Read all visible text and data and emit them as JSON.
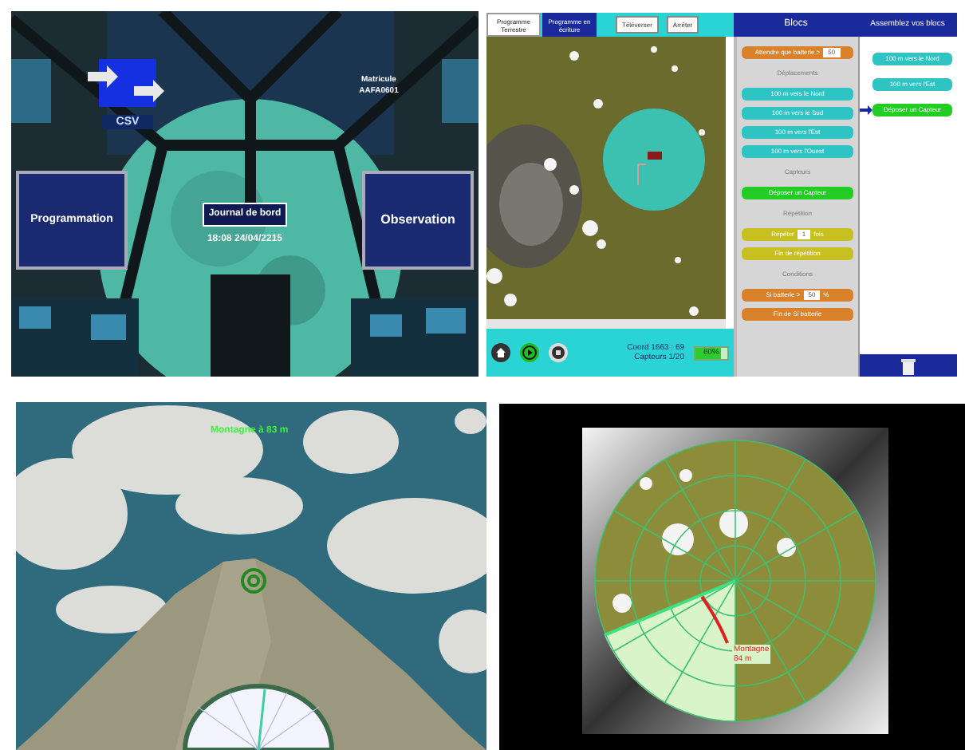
{
  "cockpit": {
    "csv_label": "CSV",
    "id_label": "Matricule AAFA0601",
    "buttons": [
      "Programmation",
      "Observation"
    ],
    "logbook": "Journal de bord",
    "timestamp": "18:08 24/04/2215"
  },
  "programming": {
    "tabs": [
      {
        "label": "Programme Terrestre",
        "selected": true
      },
      {
        "label": "Programme en écriture",
        "selected": false
      }
    ],
    "actions": [
      "Téléverser",
      "Arrêter"
    ],
    "palette_title": "Blocs",
    "workspace_title": "Assemblez vos blocs",
    "palette": [
      {
        "kind": "input",
        "label": "Attendre que batterie >",
        "value": "50",
        "color": "#d9822b"
      },
      {
        "kind": "heading",
        "label": "Déplacements"
      },
      {
        "kind": "block",
        "label": "100 m vers le Nord",
        "color": "#2ec4c4"
      },
      {
        "kind": "block",
        "label": "100 m vers le Sud",
        "color": "#2ec4c4"
      },
      {
        "kind": "block",
        "label": "100 m vers l'Est",
        "color": "#2ec4c4"
      },
      {
        "kind": "block",
        "label": "100 m vers l'Ouest",
        "color": "#2ec4c4"
      },
      {
        "kind": "heading",
        "label": "Capteurs"
      },
      {
        "kind": "block",
        "label": "Déposer un Capteur",
        "color": "#22cc22"
      },
      {
        "kind": "heading",
        "label": "Répétition"
      },
      {
        "kind": "input",
        "label": "Répéter",
        "value": "1",
        "unit": "fois",
        "color": "#c8c020"
      },
      {
        "kind": "block",
        "label": "Fin de répétition",
        "color": "#c8c020"
      },
      {
        "kind": "heading",
        "label": "Conditions"
      },
      {
        "kind": "input",
        "label": "Si batterie >",
        "value": "50",
        "unit": "%",
        "color": "#d9822b"
      },
      {
        "kind": "block",
        "label": "Fin de Si batterie",
        "color": "#d9822b"
      }
    ],
    "program": [
      {
        "label": "100 m vers le Nord",
        "color": "#2ec4c4",
        "current": false
      },
      {
        "label": "100 m vers l'Est",
        "color": "#2ec4c4",
        "current": false
      },
      {
        "label": "Déposer un Capteur",
        "color": "#22cc22",
        "current": true
      }
    ],
    "coords": "Coord 1663 : 69",
    "sensors": "Capteurs 1/20",
    "battery": {
      "level": 0.6,
      "reading": "60%"
    }
  },
  "terrain": {
    "reading": "Montagne à 83 m"
  },
  "radar": {
    "label": "Montagne",
    "distance": "84 m"
  }
}
